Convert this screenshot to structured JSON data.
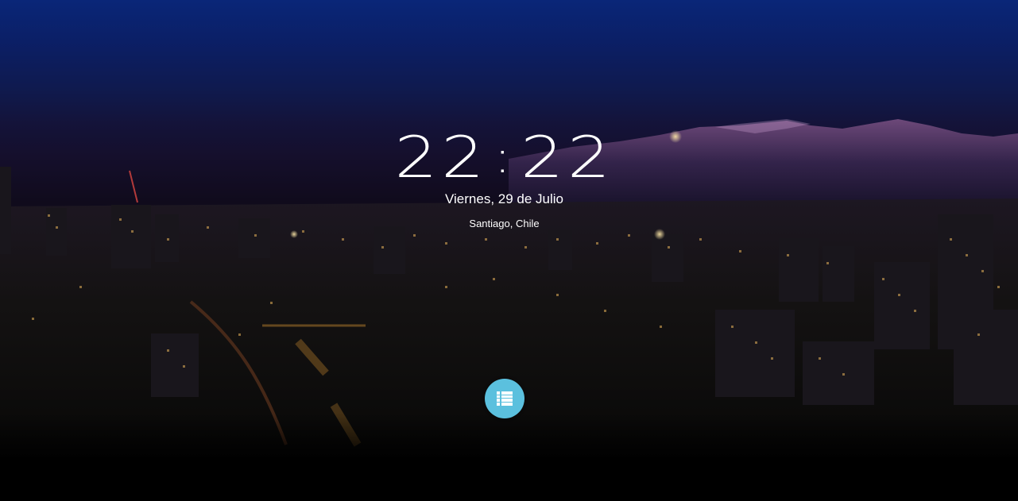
{
  "clock": {
    "hours": "22",
    "separator": ":",
    "minutes": "22"
  },
  "date_text": "Viernes, 29 de Julio",
  "location_text": "Santiago, Chile",
  "menu_button": {
    "icon": "list-icon",
    "color": "#5bc0de"
  },
  "background": {
    "description_icon": "night-city-skyline",
    "sky_color_top": "#0a2678",
    "accent_light_color": "#f0c060"
  }
}
